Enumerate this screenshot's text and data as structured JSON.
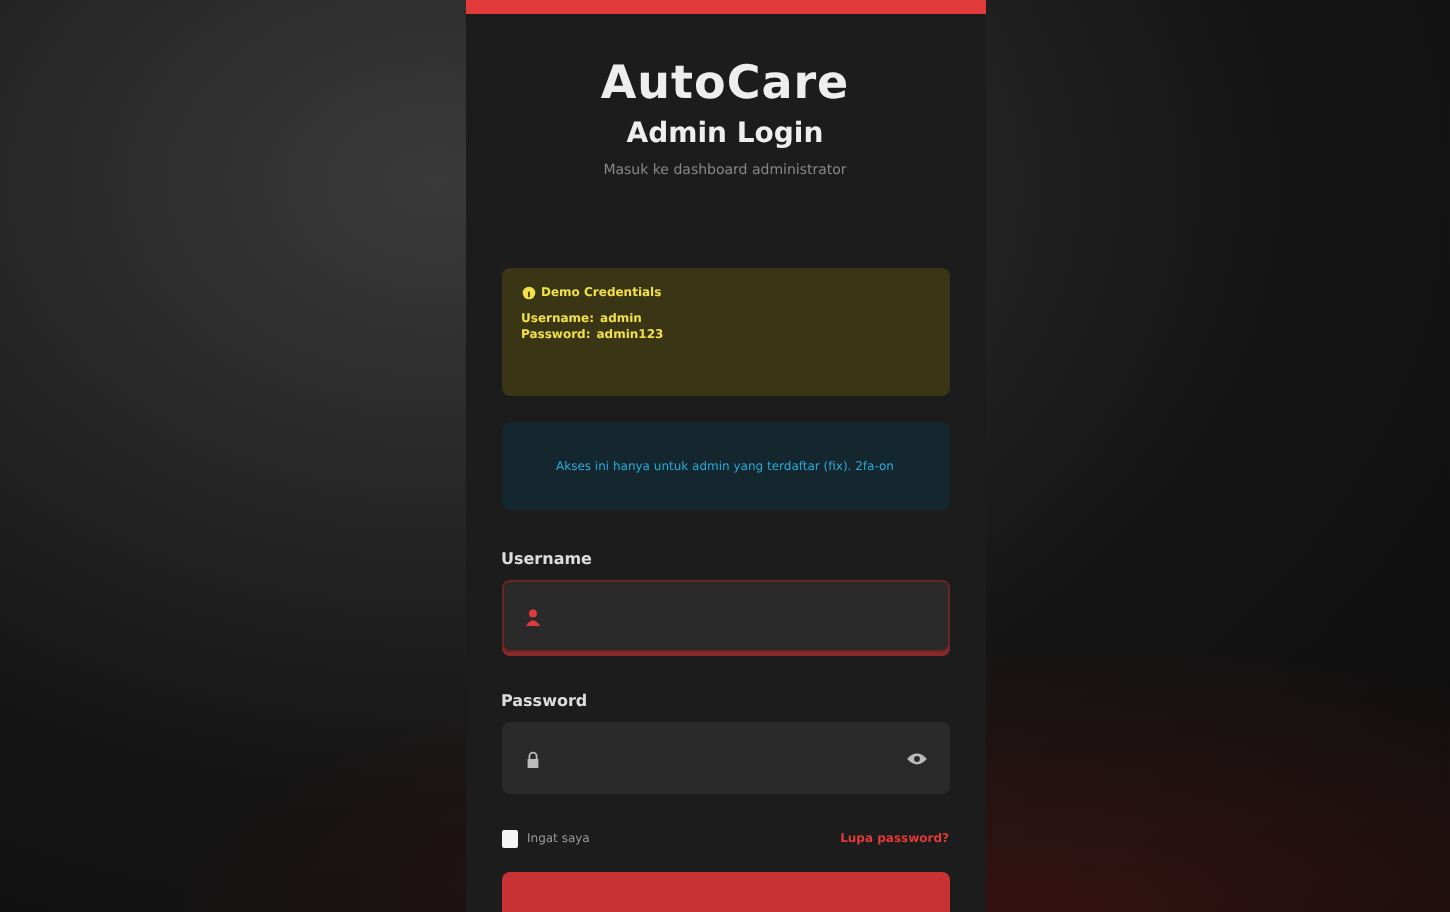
{
  "brand": "AutoCare",
  "title": "Admin Login",
  "subtitle": "Masuk ke dashboard administrator",
  "demo": {
    "heading": "Demo Credentials",
    "lines": [
      {
        "label": "Username:",
        "value": "admin"
      },
      {
        "label": "Password:",
        "value": "admin123"
      }
    ]
  },
  "info": "Akses ini hanya untuk admin yang terdaftar (fix). 2fa-on",
  "fields": [
    {
      "label": "Username",
      "kind": "user",
      "focused": true
    },
    {
      "label": "Password",
      "kind": "password",
      "focused": false
    }
  ],
  "remember": {
    "label": "Ingat saya",
    "checked": false
  },
  "forgot": "Lupa password?"
}
